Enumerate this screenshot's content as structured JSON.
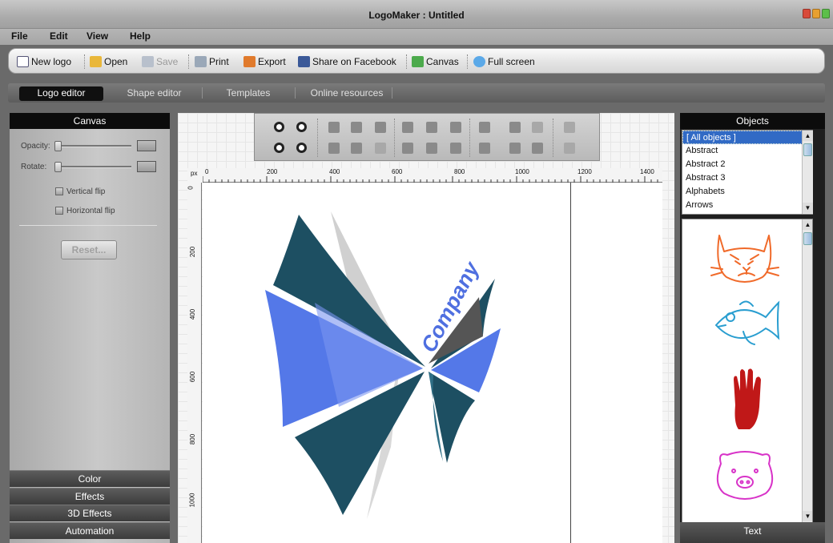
{
  "window": {
    "title": "LogoMaker : Untitled"
  },
  "menu": [
    "File",
    "Edit",
    "View",
    "Help"
  ],
  "toolbar": {
    "new_logo": "New logo",
    "open": "Open",
    "save": "Save",
    "print": "Print",
    "export": "Export",
    "share": "Share on Facebook",
    "canvas": "Canvas",
    "fullscreen": "Full screen"
  },
  "tabs": [
    "Logo editor",
    "Shape editor",
    "Templates",
    "Online resources"
  ],
  "left_panel": {
    "header": "Canvas",
    "opacity_label": "Opacity:",
    "rotate_label": "Rotate:",
    "vertical_flip": "Vertical flip",
    "horizontal_flip": "Horizontal flip",
    "reset": "Reset...",
    "sections": [
      "Color",
      "Effects",
      "3D Effects",
      "Automation"
    ]
  },
  "ruler": {
    "unit": "px",
    "h_ticks": [
      "0",
      "200",
      "400",
      "600",
      "800",
      "1000",
      "1200",
      "1400"
    ],
    "v_ticks": [
      "0",
      "200",
      "400",
      "600",
      "800",
      "1000"
    ]
  },
  "logo": {
    "text": "Company"
  },
  "right_panel": {
    "header": "Objects",
    "categories": [
      "[ All objects ]",
      "Abstract",
      "Abstract 2",
      "Abstract 3",
      "Alphabets",
      "Arrows"
    ],
    "selected_category": "[ All objects ]",
    "shape_icons": [
      "cat-face-icon",
      "fish-icon",
      "hand-icon",
      "pig-face-icon"
    ],
    "footer": "Text"
  },
  "colors": {
    "accent_blue": "#316ac5",
    "logo_dark_teal": "#1d4f62",
    "logo_bright_blue": "#5478e8"
  }
}
